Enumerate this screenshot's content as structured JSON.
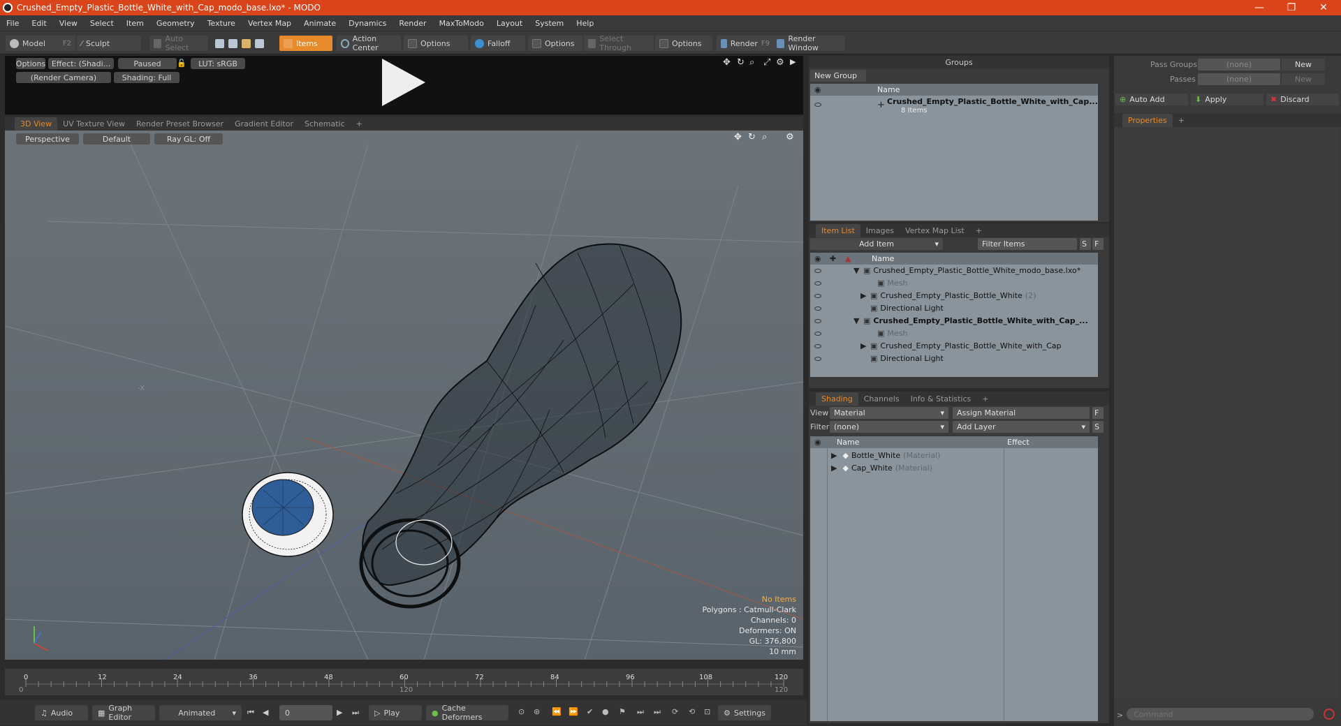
{
  "window": {
    "title": "Crushed_Empty_Plastic_Bottle_White_with_Cap_modo_base.lxo* - MODO",
    "minimize": "—",
    "maximize": "❐",
    "close": "✕"
  },
  "menu": [
    "File",
    "Edit",
    "View",
    "Select",
    "Item",
    "Geometry",
    "Texture",
    "Vertex Map",
    "Animate",
    "Dynamics",
    "Render",
    "MaxToModo",
    "Layout",
    "System",
    "Help"
  ],
  "toolbar": {
    "model": "Model",
    "model_key": "F2",
    "sculpt": "Sculpt",
    "auto_select": "Auto Select",
    "items": "Items",
    "action_center": "Action Center",
    "options1": "Options",
    "falloff": "Falloff",
    "options2": "Options",
    "select_through": "Select Through",
    "options3": "Options",
    "render": "Render",
    "render_key": "F9",
    "render_window": "Render Window"
  },
  "preview": {
    "options": "Options",
    "effect": "Effect: (Shadi...",
    "paused": "Paused",
    "lut": "LUT: sRGB",
    "camera": "(Render Camera)",
    "shading": "Shading: Full"
  },
  "view_tabs": [
    "3D View",
    "UV Texture View",
    "Render Preset Browser",
    "Gradient Editor",
    "Schematic",
    "+"
  ],
  "viewport": {
    "perspective": "Perspective",
    "default": "Default",
    "raygl": "Ray GL: Off",
    "axis_label": "-X",
    "info": {
      "no_items": "No Items",
      "polygons": "Polygons : Catmull-Clark",
      "channels": "Channels: 0",
      "deformers": "Deformers: ON",
      "gl": "GL: 376,800",
      "scale": "10 mm"
    }
  },
  "timeline": {
    "ticks": [
      "0",
      "12",
      "24",
      "36",
      "48",
      "60",
      "72",
      "84",
      "96",
      "108",
      "120"
    ],
    "start": "0",
    "mid": "120",
    "end": "120"
  },
  "bottombar": {
    "audio": "Audio",
    "graph_editor": "Graph Editor",
    "animated": "Animated",
    "frame": "0",
    "play": "Play",
    "cache_deformers": "Cache Deformers",
    "settings": "Settings"
  },
  "groups": {
    "title": "Groups",
    "new_group": "New Group",
    "name_col": "Name",
    "item_name": "Crushed_Empty_Plastic_Bottle_White_with_Cap...",
    "item_count": "8 Items"
  },
  "pass": {
    "pass_groups": "Pass Groups",
    "passes": "Passes",
    "none1": "(none)",
    "none2": "(none)",
    "new1": "New",
    "new2": "New",
    "auto_add": "Auto Add",
    "apply": "Apply",
    "discard": "Discard",
    "properties": "Properties",
    "plus": "+"
  },
  "item_list": {
    "tabs": [
      "Item List",
      "Images",
      "Vertex Map List",
      "+"
    ],
    "add_item": "Add Item",
    "filter": "Filter Items",
    "s": "S",
    "f": "F",
    "name_col": "Name",
    "rows": [
      {
        "label": "Crushed_Empty_Plastic_Bottle_White_modo_base.lxo*",
        "indent": 0,
        "arrow": "▼",
        "dim": false
      },
      {
        "label": "Mesh",
        "indent": 2,
        "arrow": "",
        "dim": true
      },
      {
        "label": "Crushed_Empty_Plastic_Bottle_White",
        "suffix": "(2)",
        "indent": 1,
        "arrow": "▶",
        "dim": false
      },
      {
        "label": "Directional Light",
        "indent": 1,
        "arrow": "",
        "dim": false
      },
      {
        "label": "Crushed_Empty_Plastic_Bottle_White_with_Cap_...",
        "indent": 0,
        "arrow": "▼",
        "dim": false
      },
      {
        "label": "Mesh",
        "indent": 2,
        "arrow": "",
        "dim": true
      },
      {
        "label": "Crushed_Empty_Plastic_Bottle_White_with_Cap",
        "indent": 1,
        "arrow": "▶",
        "dim": false
      },
      {
        "label": "Directional Light",
        "indent": 1,
        "arrow": "",
        "dim": false
      }
    ]
  },
  "shading": {
    "tabs": [
      "Shading",
      "Channels",
      "Info & Statistics",
      "+"
    ],
    "view_label": "View",
    "view_value": "Material",
    "assign": "Assign Material",
    "f": "F",
    "filter_label": "Filter",
    "filter_value": "(none)",
    "add_layer": "Add Layer",
    "s": "S",
    "name_col": "Name",
    "effect_col": "Effect",
    "rows": [
      {
        "label": "Bottle_White",
        "type": "(Material)"
      },
      {
        "label": "Cap_White",
        "type": "(Material)"
      }
    ]
  },
  "command": {
    "placeholder": "Command",
    "prompt": ">"
  }
}
